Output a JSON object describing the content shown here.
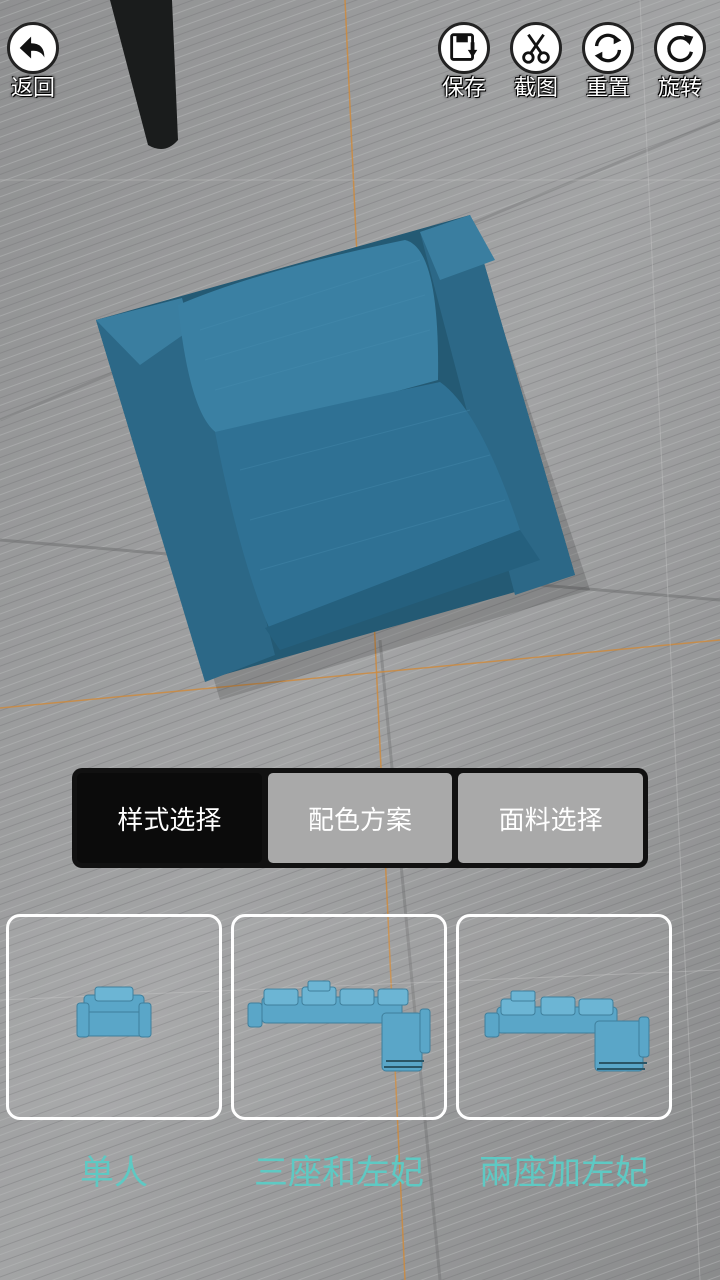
{
  "toolbar": {
    "back_label": "返回",
    "save_label": "保存",
    "screenshot_label": "截图",
    "reset_label": "重置",
    "rotate_label": "旋转"
  },
  "tabs": [
    {
      "label": "样式选择",
      "active": true
    },
    {
      "label": "配色方案",
      "active": false
    },
    {
      "label": "面料选择",
      "active": false
    }
  ],
  "styles": [
    {
      "label": "单人",
      "icon": "single-sofa"
    },
    {
      "label": "三座和左妃",
      "icon": "three-seat-left-chaise-sofa"
    },
    {
      "label": "兩座加左妃",
      "icon": "two-seat-left-chaise-sofa"
    }
  ],
  "colors": {
    "sofa": "#2f6c8a",
    "thumb_sofa": "#5aa6c8",
    "label_teal": "#5ec9c3",
    "tab_active": "#0b0b0b",
    "tab_inactive": "#a9a9a9"
  }
}
